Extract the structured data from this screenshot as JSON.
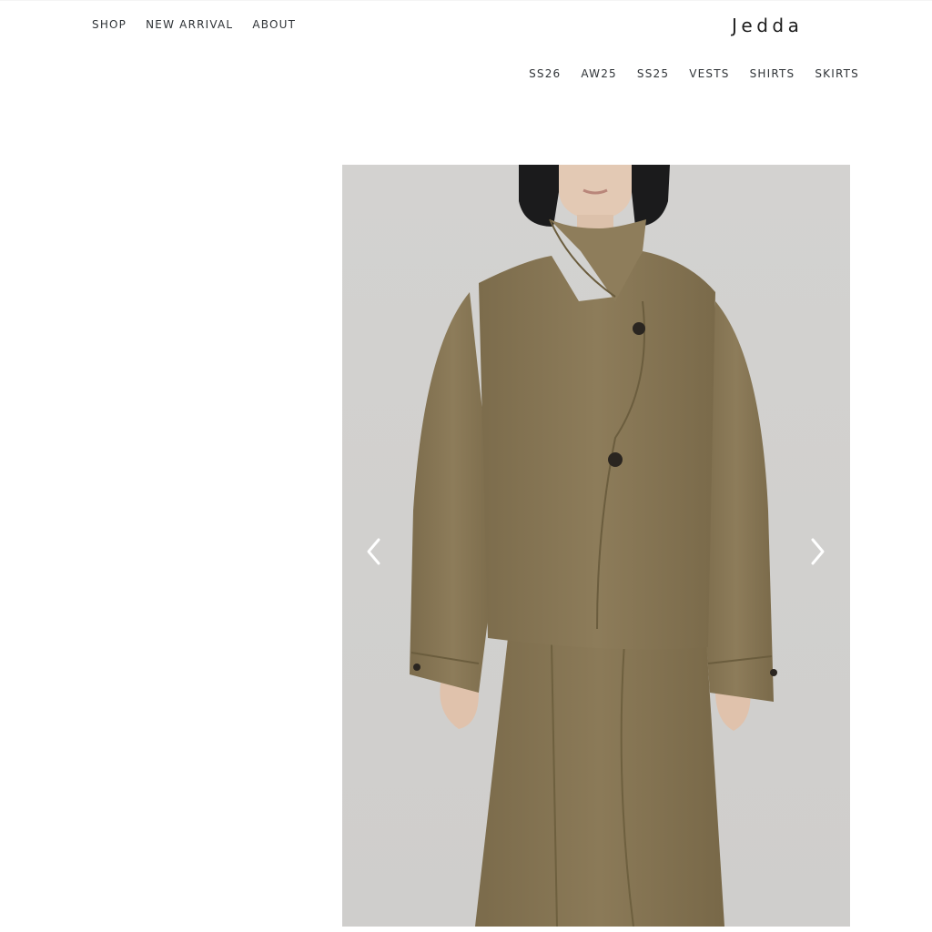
{
  "header": {
    "primary_nav": [
      "SHOP",
      "NEW ARRIVAL",
      "ABOUT"
    ],
    "logo": "Jedda",
    "collection_nav": [
      "SS26",
      "AW25",
      "SS25",
      "VESTS",
      "SHIRTS",
      "SKIRTS"
    ]
  },
  "gallery": {
    "image_subject": "model wearing olive wool cropped jacket with high collar and matching skirt",
    "prev_icon": "chevron-left-icon",
    "next_icon": "chevron-right-icon"
  },
  "colors": {
    "background": "#ffffff",
    "text": "#2f3337",
    "photo_backdrop": "#d2d1cf",
    "garment": "#8a7a58"
  }
}
